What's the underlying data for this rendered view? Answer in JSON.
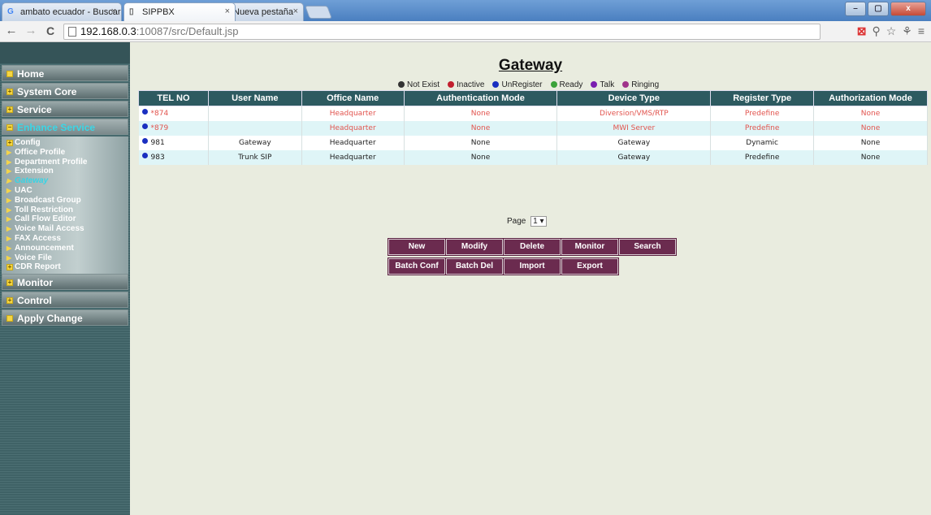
{
  "browser": {
    "tabs": [
      {
        "label": "ambato ecuador - Buscar",
        "favicon": "G",
        "close": "×"
      },
      {
        "label": "SIPPBX",
        "favicon": "▯",
        "close": "×"
      },
      {
        "label": "Nueva pestaña",
        "favicon": "",
        "close": "×"
      }
    ],
    "url_host": "192.168.0.3",
    "url_path": ":10087/src/Default.jsp",
    "back": "←",
    "forward": "→",
    "reload": "C",
    "window_buttons": {
      "minimize": "–",
      "maximize": "▢",
      "close": "x"
    }
  },
  "sidebar": {
    "menus": [
      {
        "label": "Home",
        "icon": "■"
      },
      {
        "label": "System Core",
        "icon": "+"
      },
      {
        "label": "Service",
        "icon": "+"
      },
      {
        "label": "Enhance Service",
        "icon": "−"
      }
    ],
    "submenu": [
      {
        "label": "Config",
        "icon": "+"
      },
      {
        "label": "Office Profile"
      },
      {
        "label": "Department Profile"
      },
      {
        "label": "Extension"
      },
      {
        "label": "Gateway"
      },
      {
        "label": "UAC"
      },
      {
        "label": "Broadcast Group"
      },
      {
        "label": "Toll Restriction"
      },
      {
        "label": "Call Flow Editor"
      },
      {
        "label": "Voice Mail Access"
      },
      {
        "label": "FAX Access"
      },
      {
        "label": "Announcement"
      },
      {
        "label": "Voice File"
      },
      {
        "label": "CDR Report",
        "icon": "+"
      }
    ],
    "menus_after": [
      {
        "label": "Monitor",
        "icon": "+"
      },
      {
        "label": "Control",
        "icon": "+"
      },
      {
        "label": "Apply Change",
        "icon": "■"
      }
    ]
  },
  "page": {
    "title": "Gateway",
    "legend": [
      {
        "label": "Not Exist",
        "color": "#333333"
      },
      {
        "label": "Inactive",
        "color": "#c21f2e"
      },
      {
        "label": "UnRegister",
        "color": "#1a2fc0"
      },
      {
        "label": "Ready",
        "color": "#3aa33a"
      },
      {
        "label": "Talk",
        "color": "#7a1fb0"
      },
      {
        "label": "Ringing",
        "color": "#a0338a"
      }
    ],
    "table": {
      "headers": [
        "TEL NO",
        "User Name",
        "Office Name",
        "Authentication Mode",
        "Device Type",
        "Register Type",
        "Authorization Mode"
      ],
      "rows": [
        {
          "tel": "*874",
          "user": "",
          "office": "Headquarter",
          "auth": "None",
          "device": "Diversion/VMS/RTP",
          "register": "Predefine",
          "authz": "None"
        },
        {
          "tel": "*879",
          "user": "",
          "office": "Headquarter",
          "auth": "None",
          "device": "MWI Server",
          "register": "Predefine",
          "authz": "None"
        },
        {
          "tel": "981",
          "user": "Gateway",
          "office": "Headquarter",
          "auth": "None",
          "device": "Gateway",
          "register": "Dynamic",
          "authz": "None"
        },
        {
          "tel": "983",
          "user": "Trunk SIP",
          "office": "Headquarter",
          "auth": "None",
          "device": "Gateway",
          "register": "Predefine",
          "authz": "None"
        }
      ]
    },
    "pager": {
      "label": "Page",
      "value": "1"
    },
    "buttons": {
      "new": "New",
      "modify": "Modify",
      "delete": "Delete",
      "monitor": "Monitor",
      "search": "Search",
      "batch_conf": "Batch Conf",
      "batch_del": "Batch Del",
      "import": "Import",
      "export": "Export"
    }
  }
}
